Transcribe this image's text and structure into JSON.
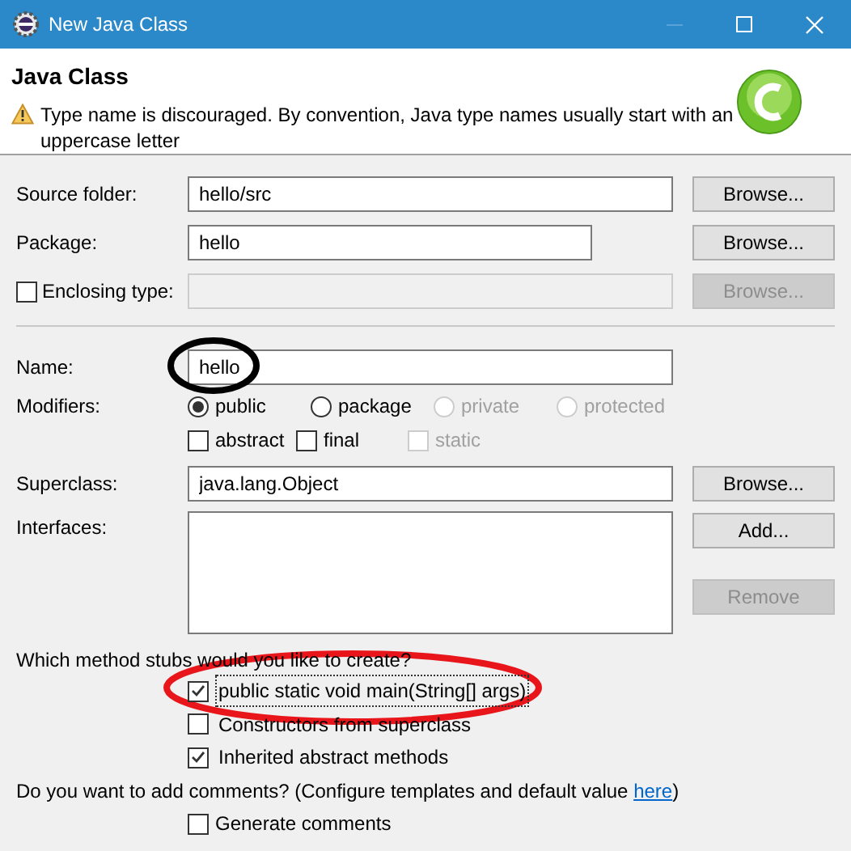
{
  "window": {
    "title": "New Java Class"
  },
  "header": {
    "title": "Java Class",
    "message": "Type name is discouraged. By convention, Java type names usually start with an uppercase letter"
  },
  "source_folder": {
    "label": "Source folder:",
    "value": "hello/src",
    "button": {
      "label": "Browse...",
      "disabled": false
    }
  },
  "package": {
    "label": "Package:",
    "value": "hello",
    "button": {
      "label": "Browse...",
      "disabled": false
    }
  },
  "enclosing_type": {
    "label": "Enclosing type:",
    "checked": false,
    "disabled": true,
    "button": {
      "label": "Browse...",
      "disabled": true
    }
  },
  "name": {
    "label": "Name:",
    "value": "hello"
  },
  "modifiers": {
    "label": "Modifiers:",
    "radios": [
      {
        "label": "public",
        "selected": true,
        "disabled": false
      },
      {
        "label": "package",
        "selected": false,
        "disabled": false
      },
      {
        "label": "private",
        "selected": false,
        "disabled": true
      },
      {
        "label": "protected",
        "selected": false,
        "disabled": true
      }
    ],
    "checkboxes": [
      {
        "label": "abstract",
        "checked": false,
        "disabled": false
      },
      {
        "label": "final",
        "checked": false,
        "disabled": false
      },
      {
        "label": "static",
        "checked": false,
        "disabled": true
      }
    ]
  },
  "superclass": {
    "label": "Superclass:",
    "value": "java.lang.Object",
    "button": {
      "label": "Browse...",
      "disabled": false
    }
  },
  "interfaces": {
    "label": "Interfaces:",
    "buttons": [
      {
        "label": "Add...",
        "disabled": false
      },
      {
        "label": "Remove",
        "disabled": true
      }
    ]
  },
  "method_stubs": {
    "question": "Which method stubs would you like to create?",
    "options": [
      {
        "label": "public static void main(String[] args)",
        "checked": true,
        "focused": true
      },
      {
        "label": "Constructors from superclass",
        "checked": false,
        "focused": false
      },
      {
        "label": "Inherited abstract methods",
        "checked": true,
        "focused": false
      }
    ]
  },
  "comments": {
    "question": "Do you want to add comments? (Configure templates and default value ",
    "link": "here",
    "question_end": ")",
    "option": {
      "label": "Generate comments",
      "checked": false
    }
  }
}
